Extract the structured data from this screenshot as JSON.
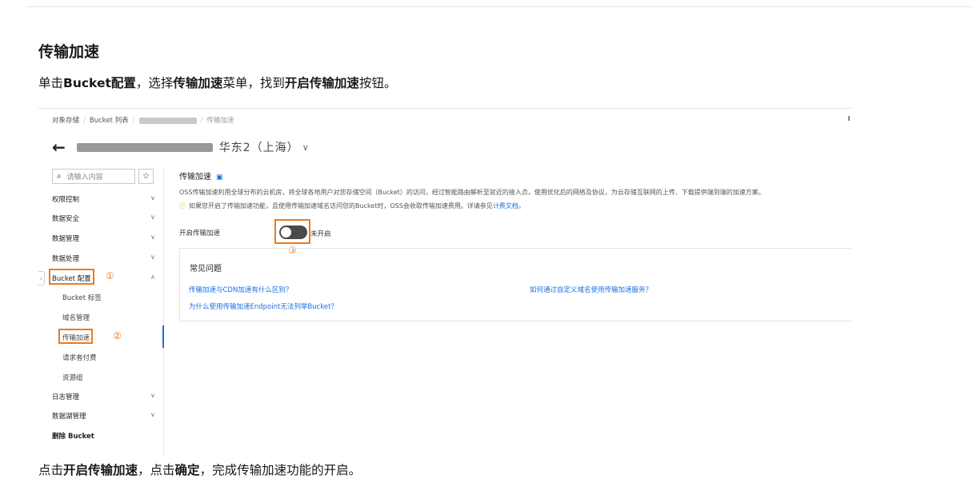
{
  "doc": {
    "heading": "传输加速",
    "step1": {
      "a": "单击",
      "b": "Bucket配置",
      "c": "，选择",
      "d": "传输加速",
      "e": "菜单，找到",
      "f": "开启传输加速",
      "g": "按钮。"
    },
    "step2": {
      "a": "点击",
      "b": "开启传输加速",
      "c": "，点击",
      "d": "确定",
      "e": "，完成传输加速功能的开启。"
    }
  },
  "console": {
    "breadcrumb": {
      "root": "对象存储",
      "list": "Bucket 列表",
      "current": "传输加速"
    },
    "region": "华东2（上海）",
    "search_placeholder": "请输入内容",
    "star": "☆",
    "search_icon": "search-icon",
    "nav": [
      {
        "label": "权限控制"
      },
      {
        "label": "数据安全"
      },
      {
        "label": "数据管理"
      },
      {
        "label": "数据处理"
      },
      {
        "label": "Bucket 配置"
      },
      {
        "label": "Bucket 标签"
      },
      {
        "label": "域名管理"
      },
      {
        "label": "传输加速"
      },
      {
        "label": "请求者付费"
      },
      {
        "label": "资源组"
      },
      {
        "label": "日志管理"
      },
      {
        "label": "数据湖管理"
      },
      {
        "label": "删除 Bucket"
      }
    ],
    "markers": {
      "one": "①",
      "two": "②",
      "three": "③"
    },
    "panel": {
      "title": "传输加速",
      "desc": "OSS传输加速利用全球分布的云机房，将全球各地用户对您存储空间（Bucket）的访问，经过智能路由解析至就近的接入点，使用优化后的网络及协议，为云存储互联网的上传、下载提供端到端的加速方案。",
      "notice": "如果您开启了传输加速功能，且使用传输加速域名访问您的Bucket时，OSS会收取传输加速费用。详请参见",
      "notice_link": "计费文档",
      "notice_end": "。",
      "toggle_label": "开启传输加速",
      "toggle_state": "未开启",
      "toggle_on": false
    },
    "faq": {
      "title": "常见问题",
      "links": [
        "传输加速与CDN加速有什么区别？",
        "如何通过自定义域名使用传输加速服务？",
        "为什么使用传输加速Endpoint无法列举Bucket？"
      ]
    },
    "colors": {
      "highlight": "#ec7a1f",
      "link": "#1a6fdf",
      "toggle_off": "#4a4a4a"
    }
  }
}
